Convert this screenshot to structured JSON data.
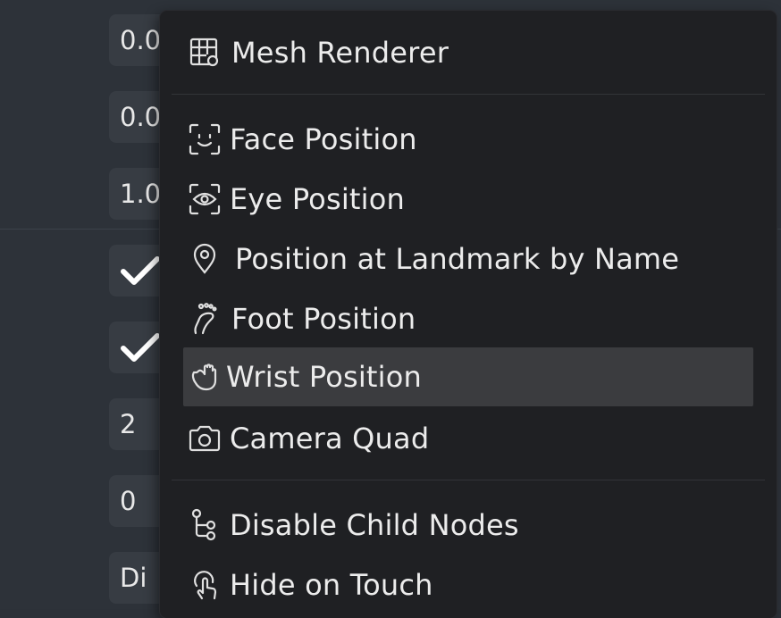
{
  "background_fields": [
    {
      "value": "0.0"
    },
    {
      "value": "0.0"
    },
    {
      "value": "1.0"
    },
    {
      "checked": true
    },
    {
      "checked": true
    },
    {
      "value": "2"
    },
    {
      "value": "0"
    },
    {
      "value": "Di"
    }
  ],
  "menu": {
    "items": [
      {
        "label": "Mesh Renderer",
        "icon": "grid-gear-icon"
      },
      {
        "label": "Face Position",
        "icon": "face-scan-icon"
      },
      {
        "label": "Eye Position",
        "icon": "eye-scan-icon"
      },
      {
        "label": "Position at Landmark by Name",
        "icon": "location-pin-icon"
      },
      {
        "label": "Foot Position",
        "icon": "foot-icon"
      },
      {
        "label": "Wrist Position",
        "icon": "hand-icon",
        "highlighted": true
      },
      {
        "label": "Camera Quad",
        "icon": "camera-icon"
      },
      {
        "label": "Disable Child Nodes",
        "icon": "node-tree-icon"
      },
      {
        "label": "Hide on Touch",
        "icon": "touch-icon"
      }
    ]
  }
}
